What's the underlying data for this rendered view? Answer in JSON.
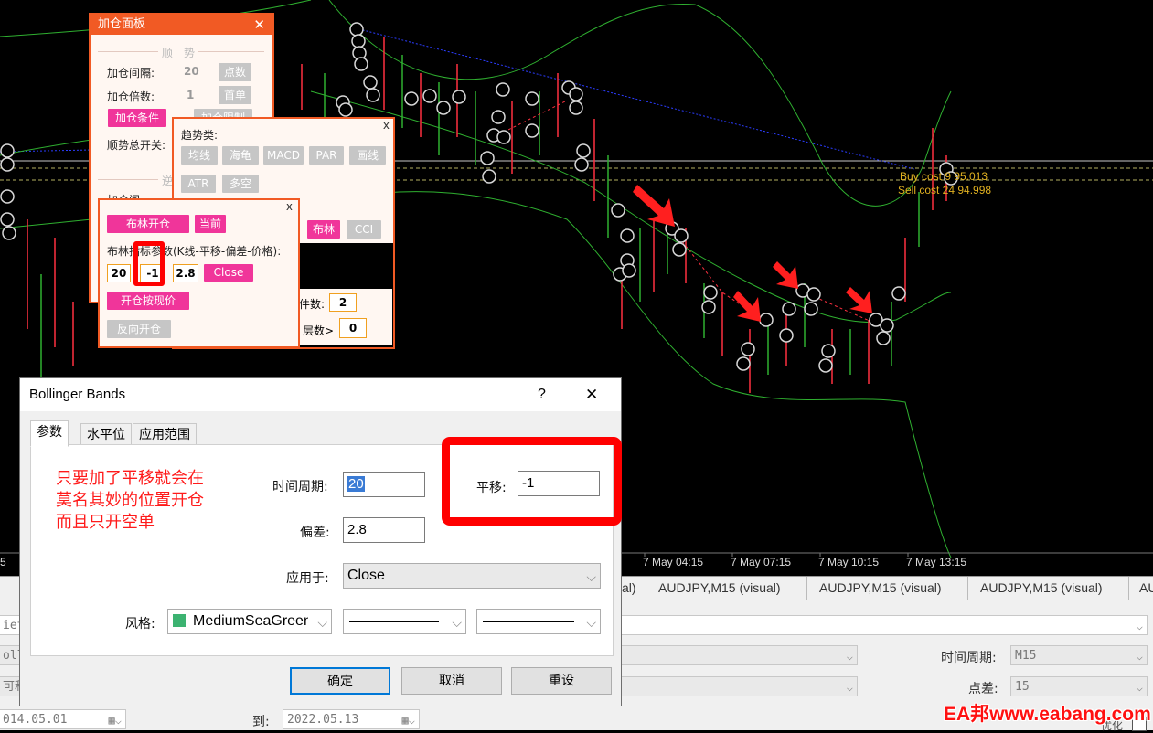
{
  "colors": {
    "accent": "#f15a24",
    "pink": "#f0359a",
    "red_highlight": "#ff0000",
    "chart_bg": "#000000",
    "band": "#2fb030",
    "watermark": "#ff0000"
  },
  "chart": {
    "buy_cost_label": "Buy cost 9 95.013",
    "sell_cost_label": "Sell cost 24 94.998",
    "time_labels": [
      "5",
      "7 May 04:15",
      "7 May 07:15",
      "7 May 10:15",
      "7 May 13:15"
    ]
  },
  "tabs_row": {
    "items": [
      "al)",
      "AUDJPY,M15 (visual)",
      "AUDJPY,M15 (visual)",
      "AUDJPY,M15 (visual)",
      "AU"
    ]
  },
  "tester": {
    "field1": "iet_",
    "field2": "olla",
    "field3": "可利",
    "date_from": "014.05.01",
    "to_label": "到:",
    "date_to": "2022.05.13",
    "period_label": "时间周期:",
    "period_value": "M15",
    "spread_label": "点差:",
    "spread_value": "15",
    "optimize_label": "优化"
  },
  "add_panel": {
    "title": "加仓面板",
    "close": "✕",
    "section_trend": "顺　势",
    "interval_label": "加仓间隔:",
    "interval_value": "20",
    "points_btn": "点数",
    "multiplier_label": "加仓倍数:",
    "multiplier_value": "1",
    "first_btn": "首单",
    "condition_btn": "加仓条件",
    "limit_btn": "加仓限制",
    "trend_switch_label": "顺势总开关:",
    "section_reverse": "逆",
    "interval2_label": "加仓间",
    "count_label": "件数:",
    "count_value": "2",
    "layer_label": "层数>",
    "layer_value": "0"
  },
  "trend_panel": {
    "close": "x",
    "heading": "趋势类:",
    "buttons": [
      "均线",
      "海龟",
      "MACD",
      "PAR",
      "画线",
      "ATR",
      "多空"
    ],
    "boll_btn": "布林",
    "cci_btn": "CCI"
  },
  "boll_panel": {
    "close": "x",
    "open_btn": "布林开仓",
    "current_btn": "当前",
    "params_label": "布林指标参数(K线-平移-偏差-价格):",
    "period": "20",
    "shift": "-1",
    "deviation": "2.8",
    "price_btn": "Close",
    "open_price_btn": "开仓按现价",
    "reverse_btn": "反向开仓"
  },
  "dialog": {
    "title": "Bollinger Bands",
    "help": "?",
    "close": "✕",
    "tabs": [
      "参数",
      "水平位",
      "应用范围"
    ],
    "annotation_lines": [
      "只要加了平移就会在",
      "莫名其妙的位置开仓",
      "而且只开空单"
    ],
    "period_label": "时间周期:",
    "period_value": "20",
    "shift_label": "平移:",
    "shift_value": "-1",
    "deviation_label": "偏差:",
    "deviation_value": "2.8",
    "apply_label": "应用于:",
    "apply_value": "Close",
    "style_label": "风格:",
    "style_color_name": "MediumSeaGreen",
    "style_color": "#3cb371",
    "ok": "确定",
    "cancel": "取消",
    "reset": "重设"
  },
  "watermark": "EA邦www.eabang.com"
}
